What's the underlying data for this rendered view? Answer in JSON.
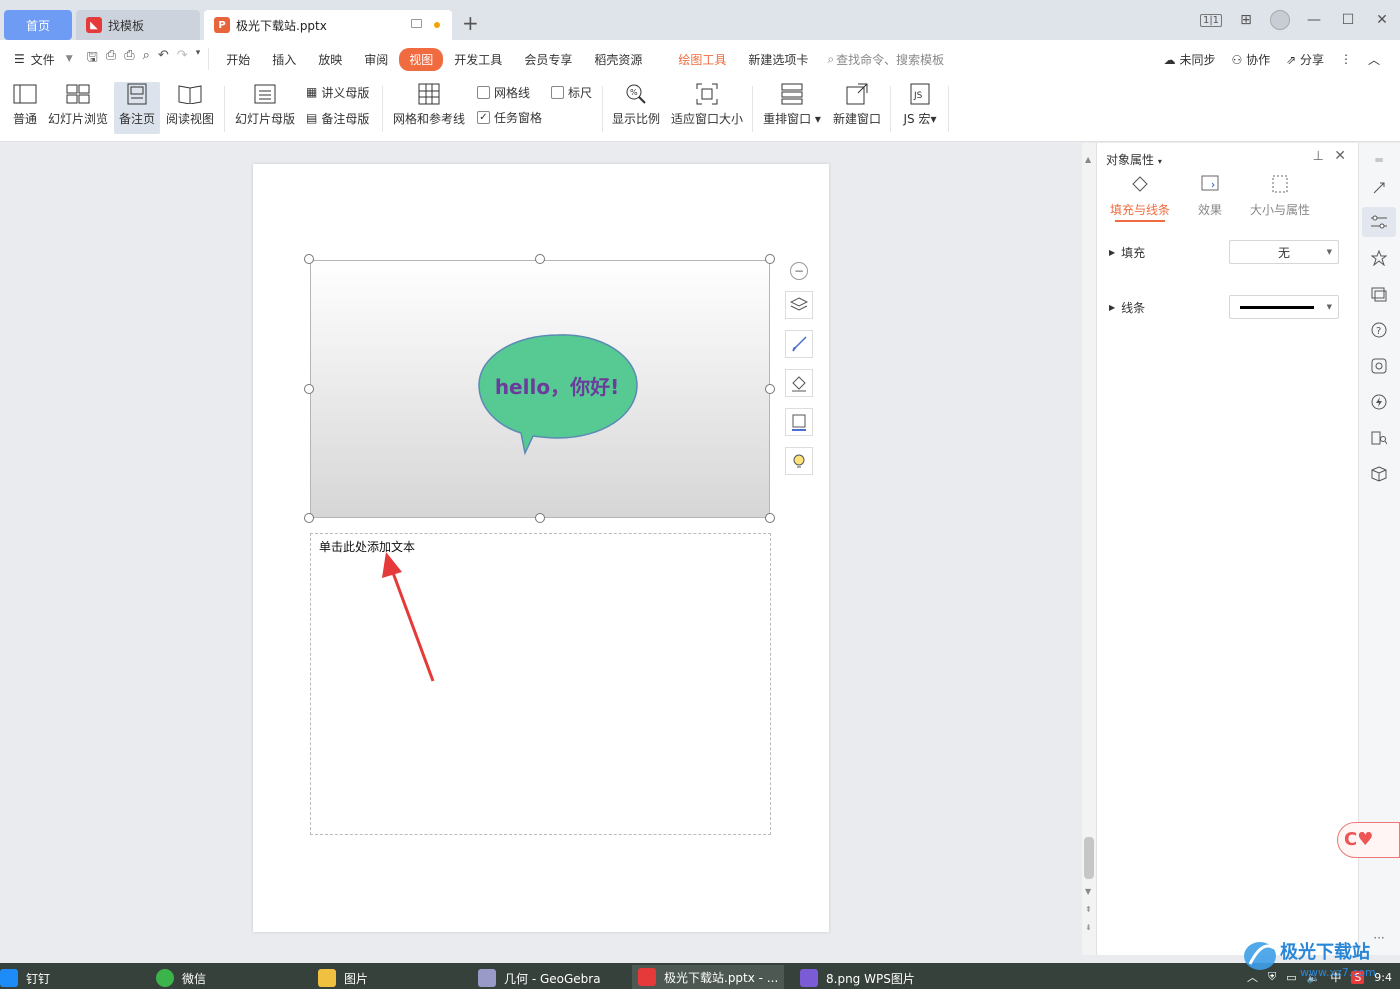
{
  "tabs": {
    "home": "首页",
    "template": "找模板",
    "document": "极光下载站.pptx"
  },
  "window_controls": {
    "layout": "1|1",
    "grid": "⊞",
    "minimize": "—",
    "maximize": "☐",
    "close": "✕"
  },
  "menu": {
    "file": "文件",
    "items": [
      "开始",
      "插入",
      "放映",
      "审阅",
      "视图",
      "开发工具",
      "会员专享",
      "稻壳资源"
    ],
    "active": "视图",
    "drawing_tools": "绘图工具",
    "new_tab": "新建选项卡",
    "search_placeholder": "查找命令、搜索模板",
    "right": {
      "sync": "未同步",
      "collab": "协作",
      "share": "分享"
    }
  },
  "ribbon": {
    "normal": "普通",
    "slide_sorter": "幻灯片浏览",
    "notes_page": "备注页",
    "reading_view": "阅读视图",
    "slide_master": "幻灯片母版",
    "handout_master": "讲义母版",
    "notes_master": "备注母版",
    "grid_guides": "网格和参考线",
    "gridlines": "网格线",
    "ruler": "标尺",
    "task_pane": "任务窗格",
    "zoom": "显示比例",
    "fit_window": "适应窗口大小",
    "rearrange": "重排窗口",
    "new_window": "新建窗口",
    "js_macro": "JS 宏",
    "gridlines_checked": false,
    "ruler_checked": false,
    "task_pane_checked": true
  },
  "slide": {
    "bubble_text": "hello，你好!",
    "bubble_color": "#57c993",
    "bubble_text_color": "#6a3c9c"
  },
  "notes": {
    "placeholder": "单击此处添加文本"
  },
  "panel": {
    "title": "对象属性",
    "tabs": [
      "填充与线条",
      "效果",
      "大小与属性"
    ],
    "fill_label": "填充",
    "fill_value": "无",
    "line_label": "线条"
  },
  "taskbar": {
    "items": [
      "钉钉",
      "微信",
      "图片",
      "几何 - GeoGebra",
      "极光下载站.pptx - ...",
      "8.png  WPS图片"
    ],
    "tray_lang": "中",
    "clock": "9:4"
  },
  "watermark": {
    "brand": "极光下载站",
    "url": "www.xz7.com"
  },
  "colors": {
    "accent": "#f06b3f",
    "home_tab": "#6e9cf5",
    "taskbar": "#37413c"
  }
}
